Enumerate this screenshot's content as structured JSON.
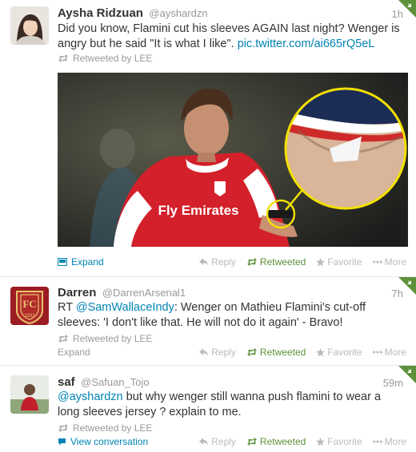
{
  "colors": {
    "link": "#0084b4",
    "retweeted_green": "#5c913b",
    "muted": "#999999",
    "name": "#333333",
    "zoom_ring": "#f2e100"
  },
  "tweets": [
    {
      "name": "Aysha Ridzuan",
      "handle": "@ayshardzn",
      "time": "1h",
      "text": "Did you know, Flamini cut his sleeves AGAIN last night? Wenger is angry but he said \"It is what I like\". ",
      "link": "pic.twitter.com/ai665rQ5eL",
      "retweeted_by": "Retweeted by LEE",
      "photo_shirt_text": "Fly Emirates",
      "expand_label": "Expand",
      "actions": {
        "reply": "Reply",
        "retweet": "Retweeted",
        "favorite": "Favorite",
        "more": "More"
      },
      "icons": [
        "retweet-icon",
        "media-icon",
        "reply-icon",
        "star-icon",
        "more-dots-icon"
      ]
    },
    {
      "name": "Darren",
      "handle": "@DarrenArsenal1",
      "time": "7h",
      "rt_prefix": "RT ",
      "mention": "@SamWallaceIndy",
      "text": ": Wenger on Mathieu Flamini's cut-off sleeves: 'I don't like that. He will not do it again' - Bravo!",
      "retweeted_by": "Retweeted by LEE",
      "badge_year": "1932",
      "expand_label": "Expand",
      "actions": {
        "reply": "Reply",
        "retweet": "Retweeted",
        "favorite": "Favorite",
        "more": "More"
      }
    },
    {
      "name": "saf",
      "handle": "@Safuan_Tojo",
      "time": "59m",
      "mention": "@ayshardzn",
      "text": " but why wenger still wanna push flamini to wear a long sleeves jersey ? explain to me.",
      "retweeted_by": "Retweeted by LEE",
      "view_conversation": "View conversation",
      "actions": {
        "reply": "Reply",
        "retweet": "Retweeted",
        "favorite": "Favorite",
        "more": "More"
      }
    }
  ]
}
